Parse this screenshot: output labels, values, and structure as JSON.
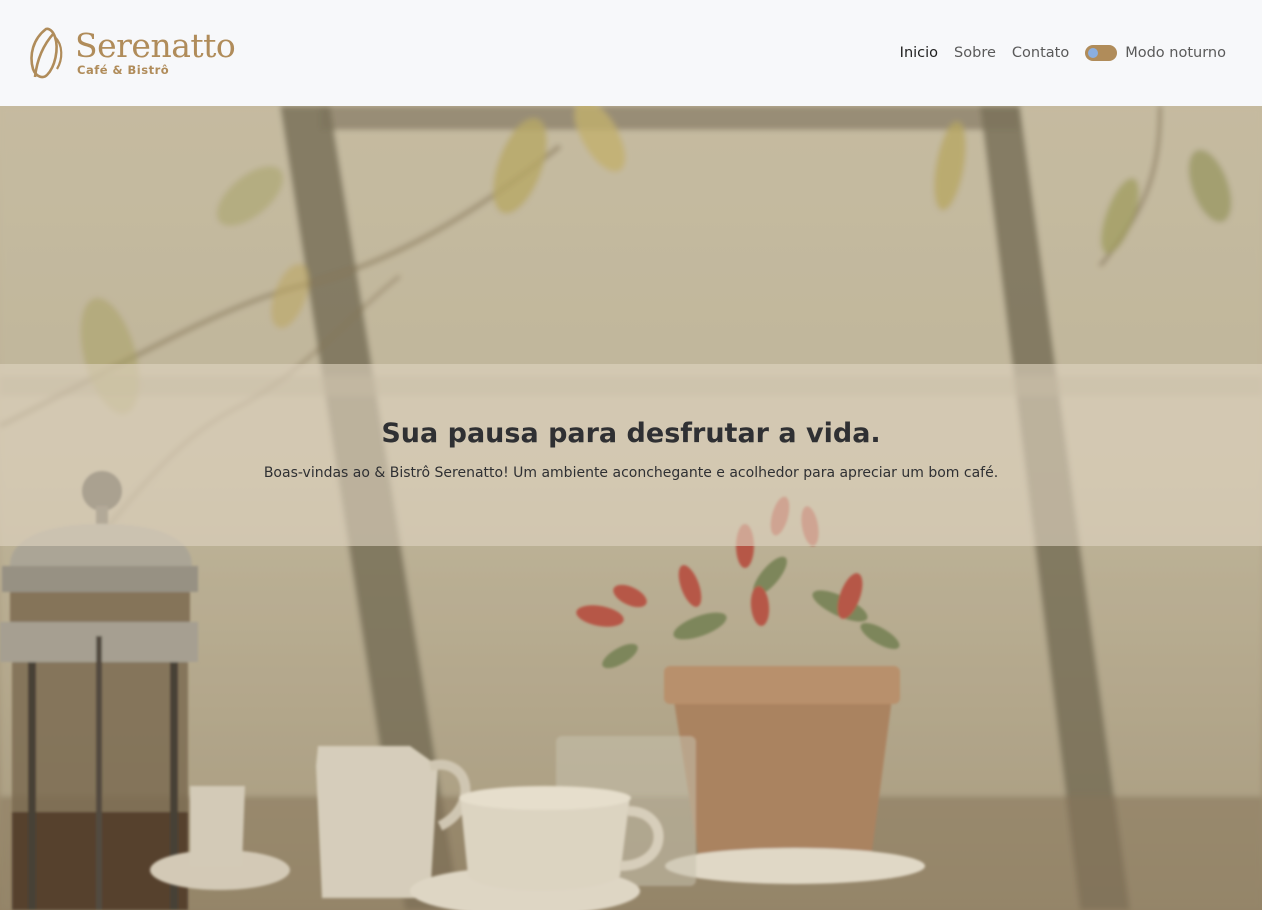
{
  "brand": {
    "name": "Serenatto",
    "tagline": "Café & Bistrô",
    "color": "#b08c5a"
  },
  "nav": {
    "items": [
      {
        "label": "Inicio",
        "active": true
      },
      {
        "label": "Sobre",
        "active": false
      },
      {
        "label": "Contato",
        "active": false
      }
    ],
    "dark_mode_label": "Modo noturno",
    "dark_mode_on": false
  },
  "hero": {
    "title": "Sua pausa para desfrutar a vida.",
    "subtitle": "Boas-vindas ao & Bistrô Serenatto! Um ambiente aconchegante e acolhedor para apreciar um bom café.",
    "background_icon": "cafe-table-photo"
  }
}
